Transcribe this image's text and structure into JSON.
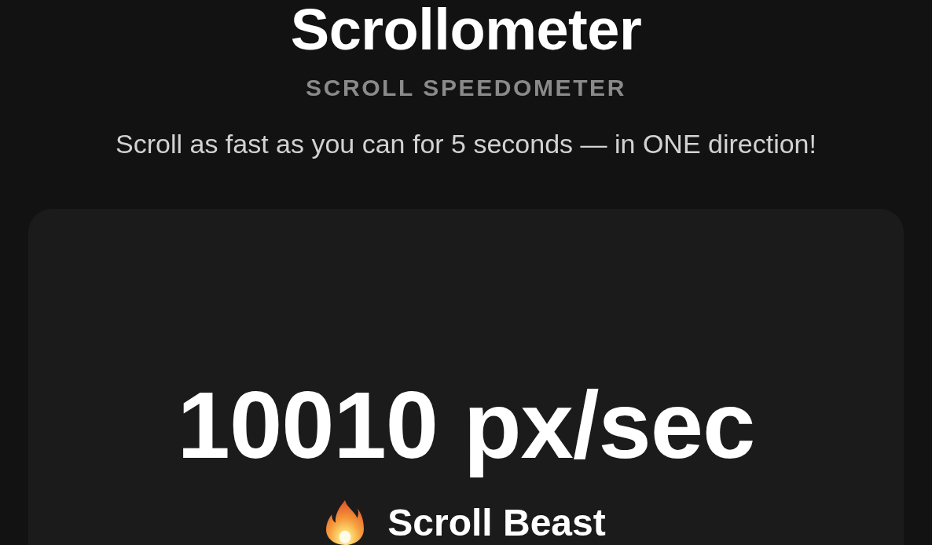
{
  "header": {
    "title": "Scrollometer",
    "subtitle": "SCROLL SPEEDOMETER",
    "instruction": "Scroll as fast as you can for 5 seconds — in ONE direction!"
  },
  "result": {
    "speed": "10010 px/sec",
    "rank": "Scroll Beast"
  }
}
